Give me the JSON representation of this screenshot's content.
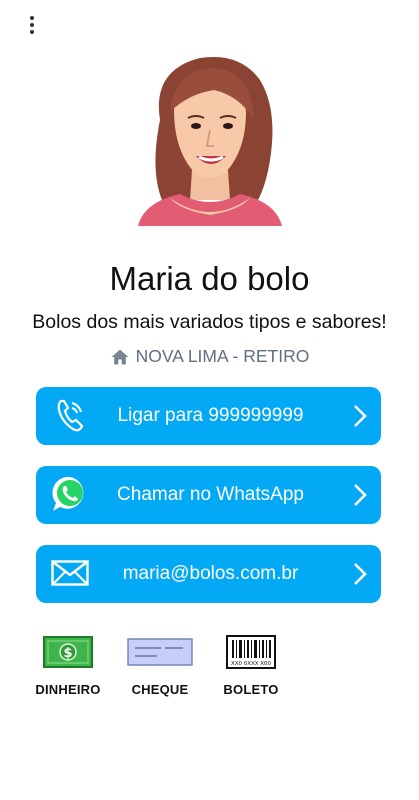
{
  "menu": {
    "icon": "more-vert-icon"
  },
  "profile": {
    "name": "Maria do bolo",
    "tagline": "Bolos dos mais variados tipos e sabores!",
    "location": "NOVA LIMA - RETIRO",
    "location_icon": "home-icon"
  },
  "actions": [
    {
      "label": "Ligar para 999999999",
      "icon": "phone-icon"
    },
    {
      "label": "Chamar no WhatsApp",
      "icon": "whatsapp-icon"
    },
    {
      "label": "maria@bolos.com.br",
      "icon": "email-icon"
    }
  ],
  "payments": [
    {
      "label": "DINHEIRO",
      "icon": "cash-icon"
    },
    {
      "label": "CHEQUE",
      "icon": "cheque-icon"
    },
    {
      "label": "BOLETO",
      "icon": "barcode-icon",
      "barcode_text": "XX0 0XXX X00"
    }
  ],
  "colors": {
    "accent": "#03a9f4",
    "muted": "#607080"
  }
}
